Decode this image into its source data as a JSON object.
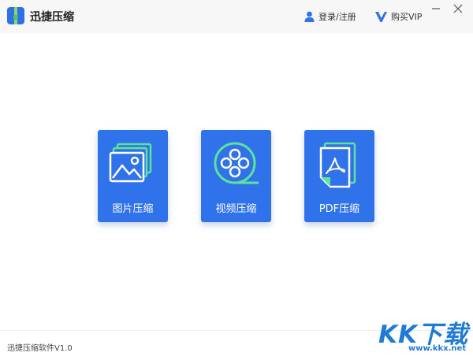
{
  "header": {
    "app_title": "迅捷压缩",
    "login_label": "登录/注册",
    "vip_label": "购买VIP"
  },
  "cards": [
    {
      "label": "图片压缩",
      "icon": "image-icon"
    },
    {
      "label": "视频压缩",
      "icon": "film-reel-icon"
    },
    {
      "label": "PDF压缩",
      "icon": "pdf-document-icon"
    }
  ],
  "footer": {
    "version": "迅捷压缩软件V1.0"
  },
  "watermark": {
    "logo_text": "KK下载",
    "url": "www.kkx.net"
  },
  "colors": {
    "accent": "#2f72ea",
    "icon_green": "#5ee39a",
    "titlebar_bg": "#f7f7f7"
  }
}
